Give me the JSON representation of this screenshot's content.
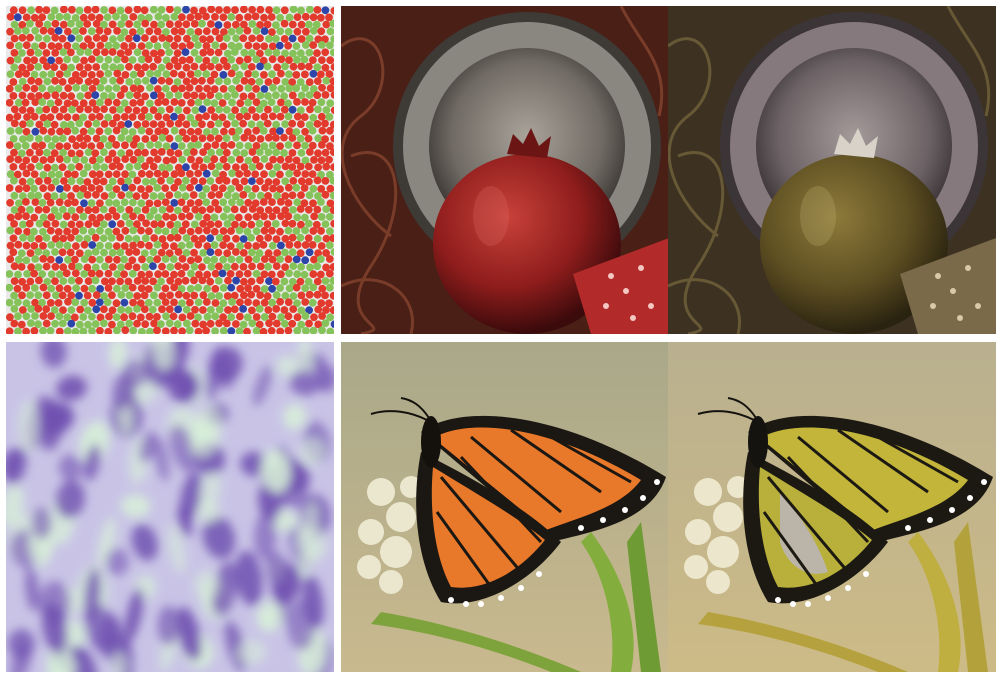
{
  "figure": {
    "panels": [
      {
        "id": "mosaic",
        "content": "cone-mosaic",
        "colors": {
          "L": "#e23a2c",
          "M": "#86c25a",
          "S": "#2d45a8",
          "background": "#e9e9e9"
        },
        "proportions": {
          "L": 0.6,
          "M": 0.37,
          "S": 0.03
        }
      },
      {
        "id": "pomegranate-original",
        "content": "pomegranate-on-plate"
      },
      {
        "id": "pomegranate-simulated",
        "content": "pomegranate-on-plate-simulated"
      },
      {
        "id": "texture",
        "content": "learned-color-texture",
        "colors": {
          "base": "#c9c4e6",
          "blob_dark": "#6f4fb0",
          "blob_light": "#d8f0d8"
        }
      },
      {
        "id": "butterfly-original",
        "content": "monarch-butterfly"
      },
      {
        "id": "butterfly-simulated",
        "content": "monarch-butterfly-simulated"
      }
    ],
    "palette": {
      "pom_fruit": "#8e1d1c",
      "pom_fruit_sim": "#6b5a26",
      "wing": "#e8782a",
      "wing_sim": "#c2b53a",
      "bg_fly": "#b7b08a",
      "bg_fly_sim": "#c6b987"
    }
  }
}
